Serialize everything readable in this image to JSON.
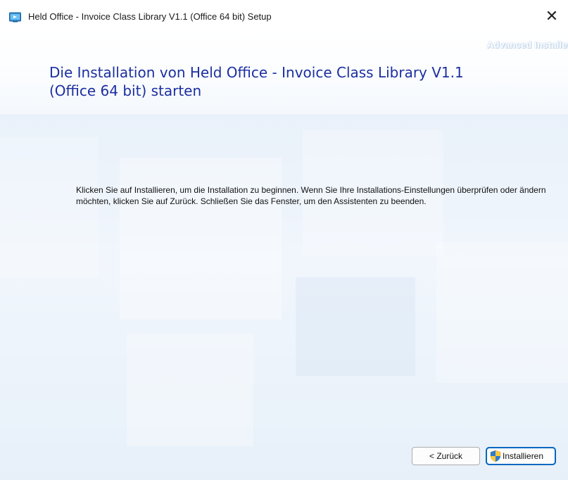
{
  "window": {
    "title": "Held Office - Invoice Class Library V1.1 (Office 64 bit) Setup",
    "close_symbol": "✕",
    "icon": "installer-app-icon"
  },
  "header": {
    "brand": "Advanced Installer",
    "title": "Die Installation von Held Office - Invoice Class Library V1.1 (Office 64 bit) starten"
  },
  "body": {
    "instructions": "Klicken Sie auf Installieren, um die Installation zu beginnen. Wenn Sie Ihre Installations-Einstellungen überprüfen oder ändern möchten, klicken Sie auf Zurück. Schließen Sie das Fenster, um den Assistenten zu beenden."
  },
  "buttons": {
    "back_label": "< Zurück",
    "install_label": "Installieren",
    "install_icon": "uac-shield-icon"
  },
  "colors": {
    "title": "#1c2fa0",
    "body_background": "#e9f1fa",
    "default_button_border": "#0067c0"
  }
}
